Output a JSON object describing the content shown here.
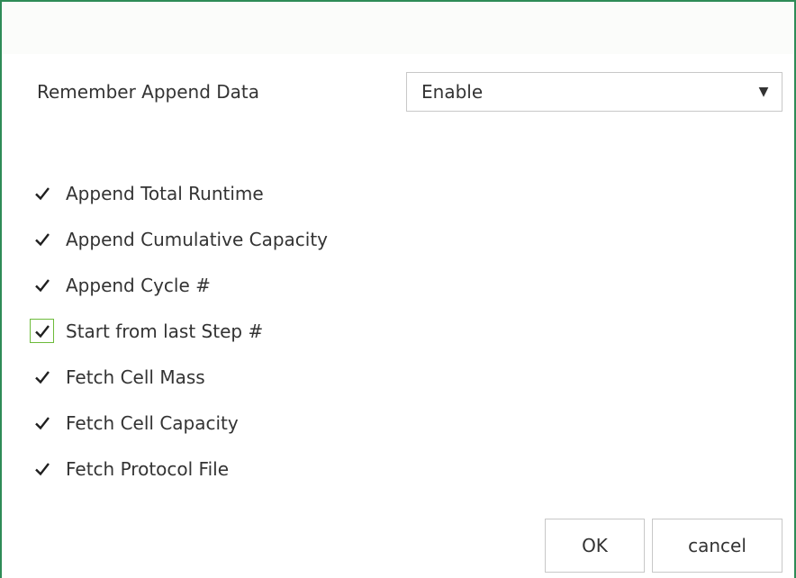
{
  "remember": {
    "label": "Remember Append Data",
    "selected": "Enable",
    "arrow_icon": "caret-down-icon"
  },
  "options": [
    {
      "label": "Append Total Runtime",
      "checked": true,
      "focused": false
    },
    {
      "label": "Append Cumulative Capacity",
      "checked": true,
      "focused": false
    },
    {
      "label": "Append Cycle #",
      "checked": true,
      "focused": false
    },
    {
      "label": "Start from last Step #",
      "checked": true,
      "focused": true
    },
    {
      "label": "Fetch Cell Mass",
      "checked": true,
      "focused": false
    },
    {
      "label": "Fetch Cell Capacity",
      "checked": true,
      "focused": false
    },
    {
      "label": "Fetch Protocol File",
      "checked": true,
      "focused": false
    }
  ],
  "buttons": {
    "ok": "OK",
    "cancel": "cancel"
  },
  "colors": {
    "border": "#2e8b57",
    "focus": "#6dbb3a"
  }
}
